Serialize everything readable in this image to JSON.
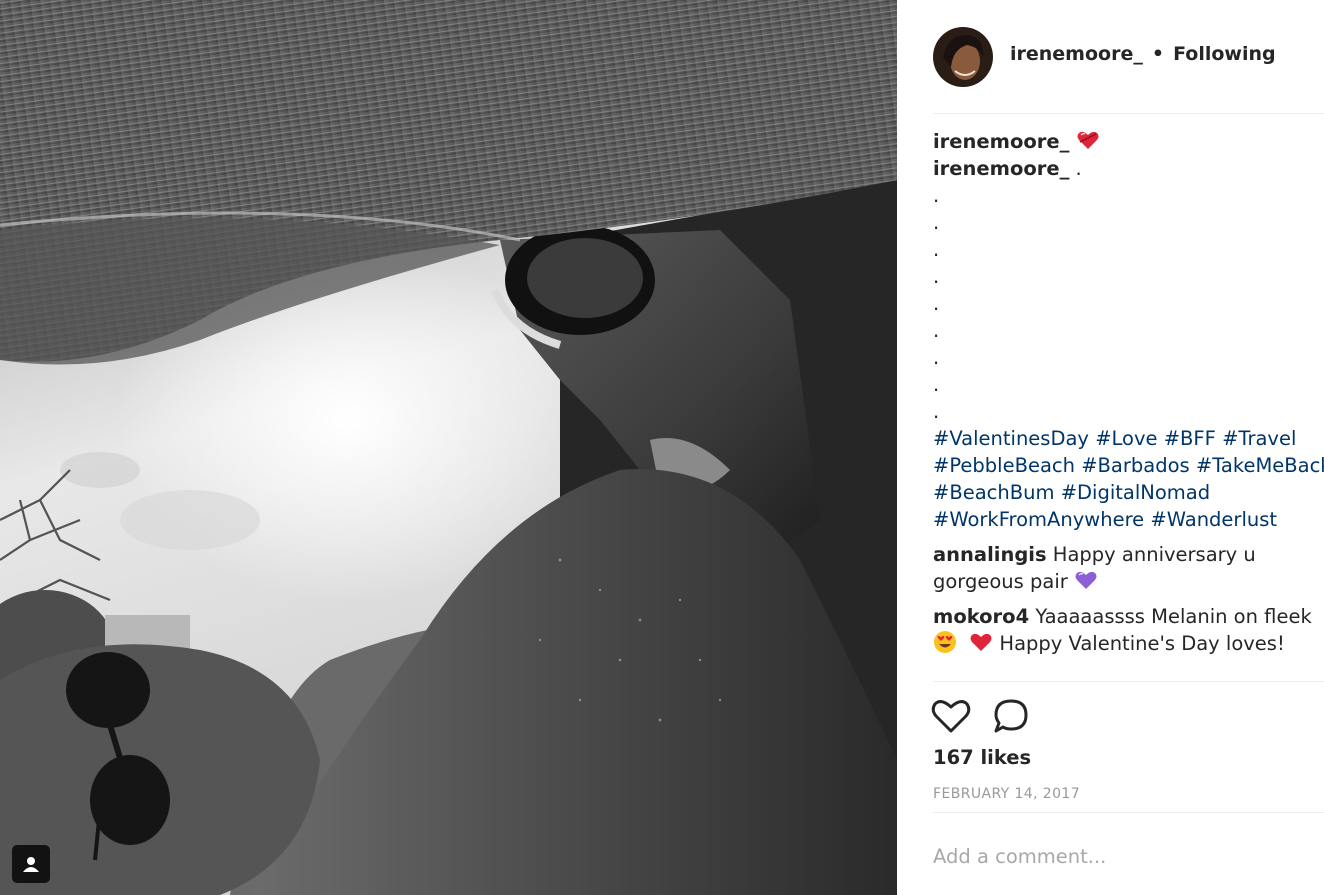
{
  "post": {
    "author": "irenemoore_",
    "separator": "•",
    "follow_state": "Following"
  },
  "caption": {
    "first": {
      "user": "irenemoore_",
      "emoji": "heart-emoji"
    },
    "second": {
      "user": "irenemoore_",
      "text": ".",
      "dots": [
        ".",
        ".",
        ".",
        ".",
        ".",
        ".",
        ".",
        ".",
        "."
      ],
      "hashtags": [
        "#ValentinesDay",
        "#Love",
        "#BFF",
        "#Travel",
        "#PebbleBeach",
        "#Barbados",
        "#TakeMeBack",
        "#BeachBum",
        "#DigitalNomad",
        "#WorkFromAnywhere",
        "#Wanderlust"
      ]
    }
  },
  "comments": [
    {
      "user": "annalingis",
      "text": "Happy anniversary u",
      "text2": "gorgeous pair",
      "emoji": "purple-heart-emoji"
    },
    {
      "user": "mokoro4",
      "text": "Yaaaaassss Melanin on fleek",
      "text2": "Happy Valentine's Day loves!",
      "emojis": [
        "heart-eyes-emoji",
        "red-heart-emoji"
      ]
    }
  ],
  "actions": {
    "like_icon": "heart-outline-icon",
    "comment_icon": "speech-bubble-icon"
  },
  "likes": "167 likes",
  "date": "FEBRUARY 14, 2017",
  "add_comment": {
    "placeholder": "Add a comment..."
  },
  "colors": {
    "hashtag": "#003569",
    "date": "#999999",
    "divider": "#efefef",
    "text": "#262626"
  }
}
